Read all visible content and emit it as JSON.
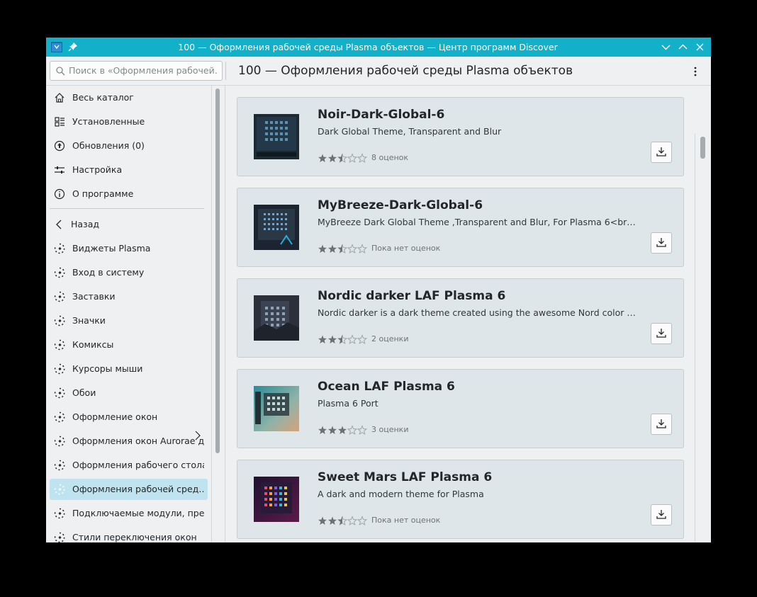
{
  "window": {
    "title": "100 — Оформления рабочей среды Plasma объектов — Центр программ Discover"
  },
  "header": {
    "search_placeholder": "Поиск в «Оформления рабочей…",
    "page_title": "100 — Оформления рабочей среды Plasma объектов"
  },
  "sidebar": {
    "main_items": [
      {
        "label": "Весь каталог",
        "icon": "home-icon"
      },
      {
        "label": "Установленные",
        "icon": "installed-list-icon"
      },
      {
        "label": "Обновления (0)",
        "icon": "updates-icon"
      },
      {
        "label": "Настройка",
        "icon": "settings-sliders-icon"
      },
      {
        "label": "О программе",
        "icon": "info-icon"
      }
    ],
    "back_label": "Назад",
    "categories": [
      {
        "label": "Виджеты Plasma"
      },
      {
        "label": "Вход в систему"
      },
      {
        "label": "Заставки"
      },
      {
        "label": "Значки"
      },
      {
        "label": "Комиксы"
      },
      {
        "label": "Курсоры мыши"
      },
      {
        "label": "Обои"
      },
      {
        "label": "Оформление окон"
      },
      {
        "label": "Оформления окон Aurorae д…"
      },
      {
        "label": "Оформления рабочего стола"
      },
      {
        "label": "Оформления рабочей сред…",
        "selected": true
      },
      {
        "label": "Подключаемые модули, пре…"
      },
      {
        "label": "Стили переключения окон"
      }
    ]
  },
  "items": [
    {
      "name": "Noir-Dark-Global-6",
      "description": "Dark Global Theme, Transparent and Blur",
      "stars": 2.5,
      "rating_text": "8 оценок"
    },
    {
      "name": "MyBreeze-Dark-Global-6",
      "description": " MyBreeze   Dark   Global   Theme ,Transparent and Blur, For Plasma 6<br…",
      "stars": 2.5,
      "rating_text": "Пока нет оценок"
    },
    {
      "name": "Nordic darker LAF Plasma 6",
      "description": "Nordic darker is a dark theme created using the awesome Nord color palette.",
      "stars": 2.5,
      "rating_text": "2 оценки"
    },
    {
      "name": "Ocean LAF Plasma 6",
      "description": "Plasma 6 Port",
      "stars": 3,
      "rating_text": "3 оценки"
    },
    {
      "name": "Sweet Mars LAF Plasma 6",
      "description": "A dark and modern theme for Plasma",
      "stars": 2.5,
      "rating_text": "Пока нет оценок"
    }
  ],
  "colors": {
    "titlebar": "#12b1c9",
    "selected": "#bfe4f0",
    "card": "#dfe6ea"
  }
}
